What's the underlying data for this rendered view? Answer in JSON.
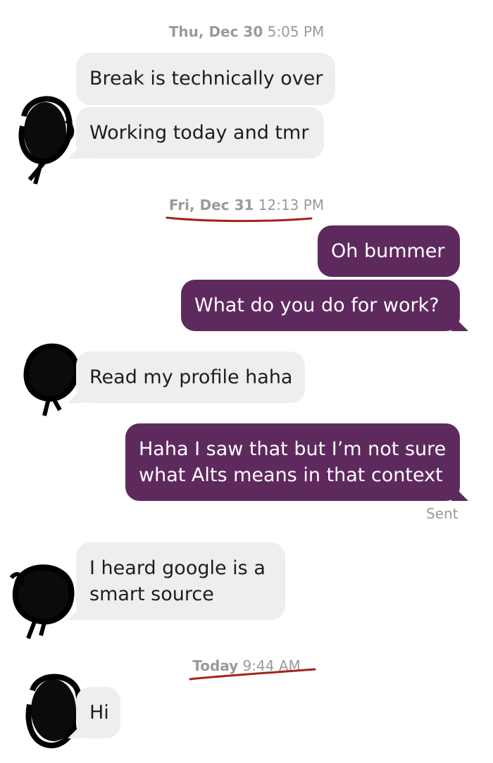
{
  "conversation": {
    "groups": [
      {
        "timestamp": {
          "day": "Thu, Dec 30",
          "time": "5:05 PM"
        },
        "messages": [
          {
            "from": "them",
            "text": "Break is technically over"
          },
          {
            "from": "them",
            "text": "Working today and tmr"
          }
        ]
      },
      {
        "timestamp": {
          "day": "Fri, Dec 31",
          "time": "12:13 PM"
        },
        "messages": [
          {
            "from": "me",
            "text": "Oh bummer"
          },
          {
            "from": "me",
            "text": "What do you do for work?"
          },
          {
            "from": "them",
            "text": "Read my profile haha"
          },
          {
            "from": "me",
            "lines": [
              "Haha I saw that but I’m not sure",
              "what Alts means in that context"
            ]
          },
          {
            "from": "them",
            "lines": [
              "I heard google is a",
              "smart source"
            ]
          }
        ],
        "status": "Sent"
      },
      {
        "timestamp": {
          "day": "Today",
          "time": "9:44 AM"
        },
        "messages": [
          {
            "from": "them",
            "text": "Hi"
          }
        ]
      }
    ]
  },
  "colors": {
    "incoming_bubble": "#eeeeee",
    "outgoing_bubble": "#5e2a5e",
    "timestamp_text": "#9a9a9a",
    "annotation_underline": "#a0241c"
  },
  "icons": [
    "scribbled-avatar-icon"
  ]
}
